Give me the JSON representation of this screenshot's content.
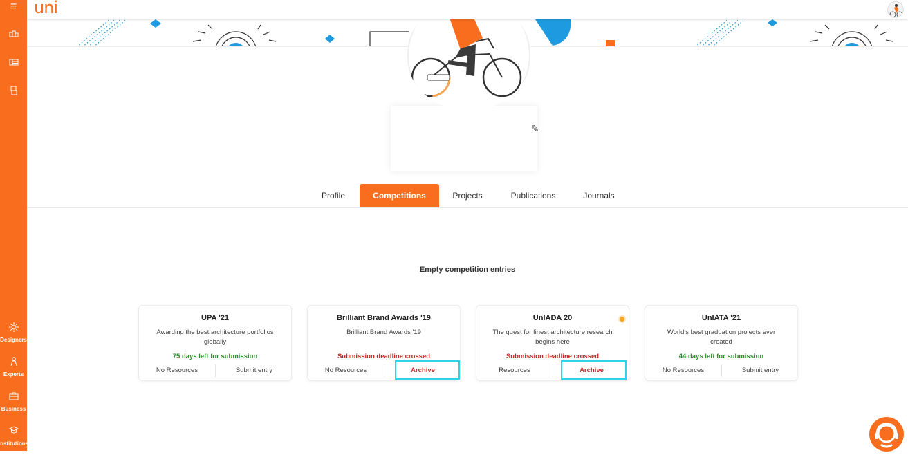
{
  "app": {
    "logo_text": "uni",
    "accent": "#f96d1e"
  },
  "sidebar": {
    "top_icons": [
      "menu-icon",
      "grid-icon",
      "list-icon",
      "document-icon"
    ],
    "items": [
      {
        "icon": "sun-icon",
        "label": "Designers"
      },
      {
        "icon": "person-icon",
        "label": "Experts"
      },
      {
        "icon": "briefcase-icon",
        "label": "Business"
      },
      {
        "icon": "graduation-cap-icon",
        "label": "Institutions"
      }
    ]
  },
  "tabs": [
    {
      "label": "Profile",
      "active": false
    },
    {
      "label": "Competitions",
      "active": true
    },
    {
      "label": "Projects",
      "active": false
    },
    {
      "label": "Publications",
      "active": false
    },
    {
      "label": "Journals",
      "active": false
    }
  ],
  "main": {
    "section_title": "Empty competition entries"
  },
  "competitions": [
    {
      "title": "UPA '21",
      "description": "Awarding the best architecture portfolios globally",
      "status": "75 days left for submission",
      "status_type": "green",
      "left_action": "No Resources",
      "right_action": "Submit entry"
    },
    {
      "title": "Brilliant Brand Awards '19",
      "description": "Brilliant Brand Awards '19",
      "status": "Submission deadline crossed",
      "status_type": "red",
      "left_action": "No Resources",
      "right_action": "Archive"
    },
    {
      "title": "UnIADA 20",
      "description": "The quest for finest architecture research begins here",
      "status": "Submission deadline crossed",
      "status_type": "red",
      "left_action": "Resources",
      "right_action": "Archive"
    },
    {
      "title": "UnIATA '21",
      "description": "World's best graduation projects ever created",
      "status": "44 days left for submission",
      "status_type": "green",
      "left_action": "No Resources",
      "right_action": "Submit entry"
    }
  ],
  "colors": {
    "highlight": "#29d6e8",
    "banner_blue": "#1e9be0",
    "status_green": "#2e8b2e",
    "status_red": "#c62828"
  }
}
